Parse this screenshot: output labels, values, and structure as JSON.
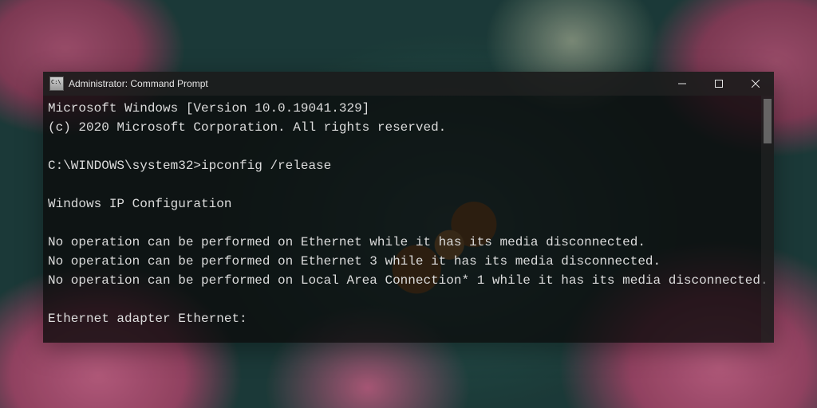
{
  "window": {
    "title": "Administrator: Command Prompt"
  },
  "terminal": {
    "lines": [
      "Microsoft Windows [Version 10.0.19041.329]",
      "(c) 2020 Microsoft Corporation. All rights reserved.",
      "",
      "C:\\WINDOWS\\system32>ipconfig /release",
      "",
      "Windows IP Configuration",
      "",
      "No operation can be performed on Ethernet while it has its media disconnected.",
      "No operation can be performed on Ethernet 3 while it has its media disconnected.",
      "No operation can be performed on Local Area Connection* 1 while it has its media disconnected.",
      "",
      "Ethernet adapter Ethernet:"
    ]
  }
}
